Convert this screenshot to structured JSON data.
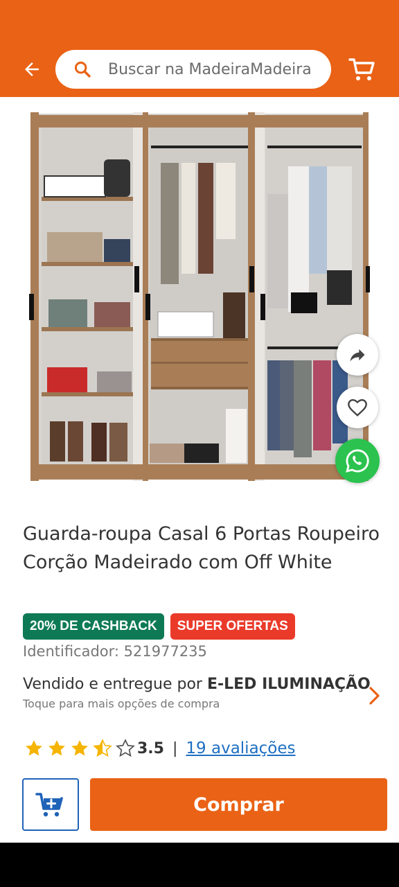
{
  "header": {
    "search_placeholder": "Buscar na MadeiraMadeira",
    "accent_color": "#ea6215"
  },
  "product": {
    "title": "Guarda-roupa Casal 6 Portas Roupeiro Corção Madeirado com Off White",
    "badges": [
      {
        "label": "20% DE CASHBACK",
        "color": "#0e7a55"
      },
      {
        "label": "SUPER OFERTAS",
        "color": "#ea3a2a"
      }
    ],
    "identifier": "Identificador: 521977235",
    "seller": {
      "prefix": "Vendido e entregue por ",
      "name": "E-LED ILUMINAÇÃO",
      "subtitle": "Toque para mais opções de compra"
    },
    "rating": {
      "value": "3.5",
      "separator": "|",
      "reviews": "19 avaliações",
      "stars_filled": 3.5,
      "stars_total": 5
    }
  },
  "actions": {
    "buy_label": "Comprar"
  },
  "icons": {
    "back": "arrow-left-icon",
    "search": "search-icon",
    "cart": "cart-icon",
    "share": "share-icon",
    "favorite": "heart-icon",
    "whatsapp": "whatsapp-icon",
    "add_to_cart": "cart-plus-icon"
  }
}
